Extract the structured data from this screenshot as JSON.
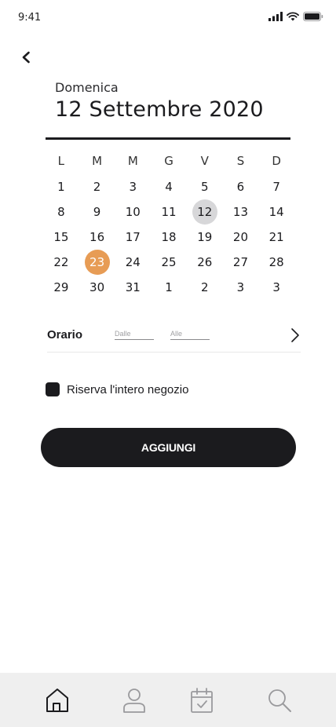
{
  "status_bar": {
    "time": "9:41"
  },
  "header": {
    "day_name": "Domenica",
    "date_title": "12 Settembre 2020"
  },
  "calendar": {
    "weekdays": [
      "L",
      "M",
      "M",
      "G",
      "V",
      "S",
      "D"
    ],
    "weeks": [
      [
        "1",
        "2",
        "3",
        "4",
        "5",
        "6",
        "7"
      ],
      [
        "8",
        "9",
        "10",
        "11",
        "12",
        "13",
        "14"
      ],
      [
        "15",
        "16",
        "17",
        "18",
        "19",
        "20",
        "21"
      ],
      [
        "22",
        "23",
        "24",
        "25",
        "26",
        "27",
        "28"
      ],
      [
        "29",
        "30",
        "31",
        "1",
        "2",
        "3",
        "3"
      ]
    ],
    "today": "12",
    "selected": "23",
    "today_color": "#d7d7d9",
    "selected_color": "#e79c55"
  },
  "time": {
    "label": "Orario",
    "from_placeholder": "Dalle",
    "to_placeholder": "Alle"
  },
  "option": {
    "reserve_label": "Riserva l'intero negozio"
  },
  "actions": {
    "add_label": "AGGIUNGI"
  },
  "tab_bar": {
    "items": [
      "home-icon",
      "profile-icon",
      "calendar-check-icon",
      "search-icon"
    ],
    "active": "home-icon"
  }
}
